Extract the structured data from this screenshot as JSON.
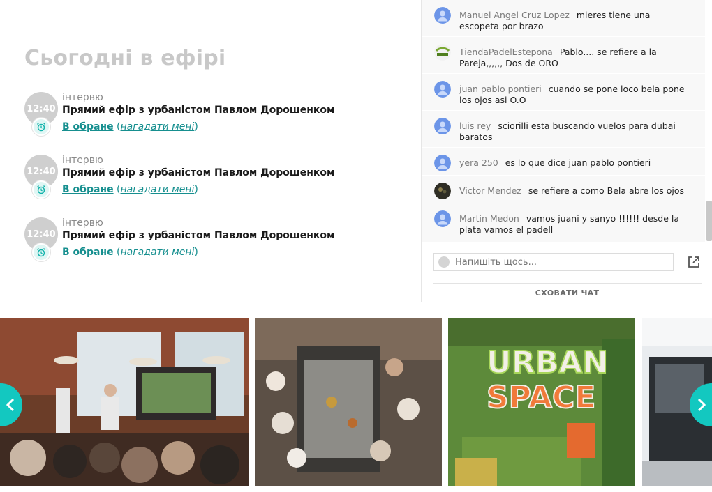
{
  "schedule": {
    "title": "Сьогодні в ефірі",
    "events": [
      {
        "time": "12:40",
        "category": "інтервю",
        "title": "Прямий ефір з урбаністом Павлом Дорошенком",
        "fav_label": "В обране",
        "open": " (",
        "remind_label": "нагадати мені",
        "close": ")"
      },
      {
        "time": "12:40",
        "category": "інтервю",
        "title": "Прямий ефір з урбаністом Павлом Дорошенком",
        "fav_label": "В обране",
        "open": " (",
        "remind_label": "нагадати мені",
        "close": ")"
      },
      {
        "time": "12:40",
        "category": "інтервю",
        "title": "Прямий ефір з урбаністом Павлом Дорошенком",
        "fav_label": "В обране",
        "open": " (",
        "remind_label": "нагадати мені",
        "close": ")"
      }
    ]
  },
  "chat": {
    "messages": [
      {
        "author": "Manuel Angel Cruz Lopez",
        "text": "mieres tiene una escopeta por brazo",
        "avatar": "default-user-icon"
      },
      {
        "author": "TiendaPadelEstepona",
        "text": "Pablo.... se refiere a la Pareja,,,,,, Dos de ORO",
        "avatar": "spade-logo"
      },
      {
        "author": "juan pablo pontieri",
        "text": "cuando se pone loco bela pone los ojos asi O.O",
        "avatar": "default-user-icon"
      },
      {
        "author": "luis rey",
        "text": "sciorilli esta buscando vuelos para dubai baratos",
        "avatar": "default-user-icon"
      },
      {
        "author": "yera 250",
        "text": "es lo que dice juan pablo pontieri",
        "avatar": "default-user-icon"
      },
      {
        "author": "Victor Mendez",
        "text": "se refiere a como Bela abre los ojos",
        "avatar": "photo-avatar"
      },
      {
        "author": "Martin Medon",
        "text": "vamos juani y sanyo !!!!!! desde la plata vamos el padell",
        "avatar": "default-user-icon"
      }
    ],
    "input_placeholder": "Напишіть щось...",
    "hide_label": "СХОВАТИ ЧАТ"
  },
  "gallery": {
    "images": [
      "photo-presentation-audience",
      "photo-kitchen-cooks",
      "photo-urban-space-mural",
      "photo-building-entrance"
    ],
    "accent": "#13c8c0"
  },
  "colors": {
    "accent": "#13c8c0",
    "link": "#168f8f",
    "title_gray": "#c8c8c8"
  }
}
